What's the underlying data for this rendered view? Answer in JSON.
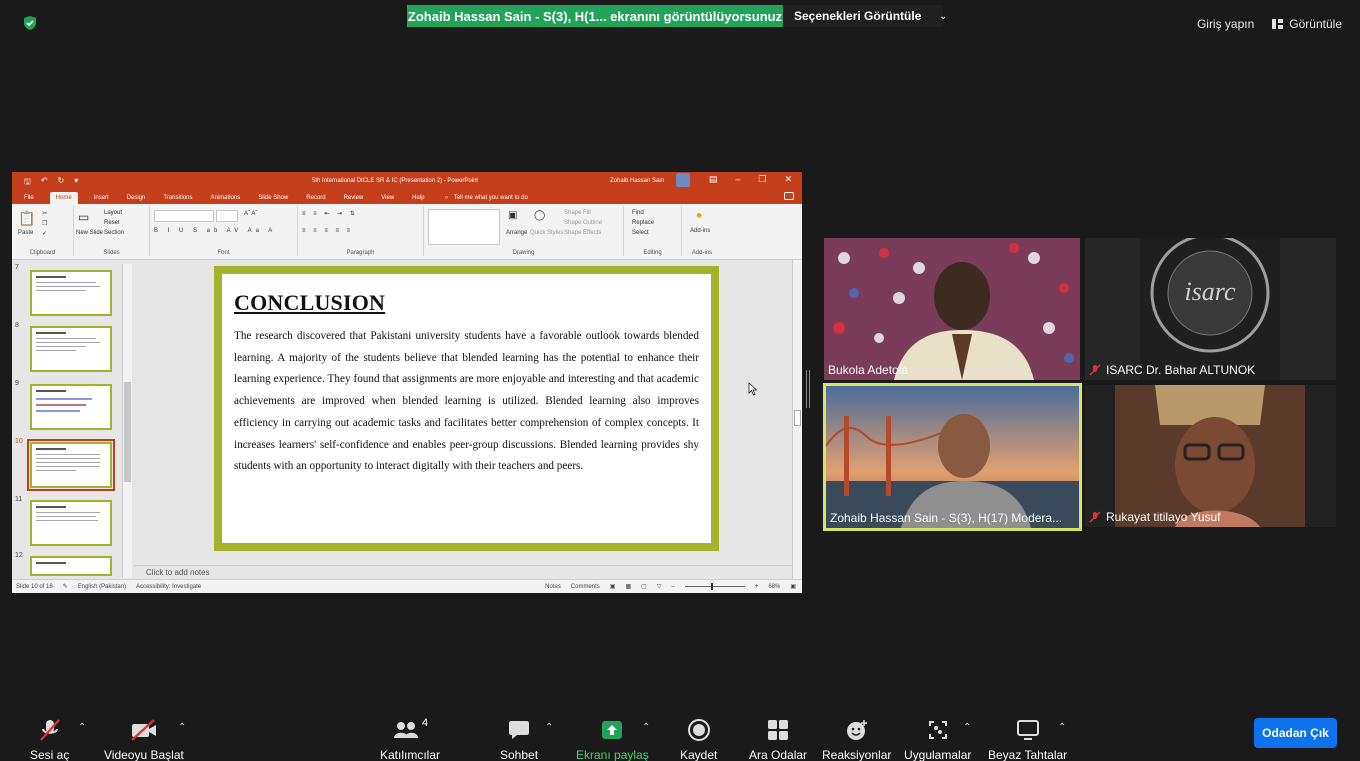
{
  "topbar": {
    "share_banner": "Zohaib Hassan Sain - S(3), H(1... ekranını görüntülüyorsunuz",
    "view_options": "Seçenekleri Görüntüle",
    "sign_in": "Giriş yapın",
    "view": "Görüntüle"
  },
  "ppt": {
    "window_title": "5th International DICLE SR & IC (Presentation 2) - PowerPoint",
    "user": "Zohaib Hassan Sain",
    "tabs": [
      "File",
      "Home",
      "Insert",
      "Design",
      "Transitions",
      "Animations",
      "Slide Show",
      "Record",
      "Review",
      "View",
      "Help"
    ],
    "tell_me": "Tell me what you want to do",
    "ribbon": {
      "paste": "Paste",
      "clipboard": "Clipboard",
      "new_slide": "New Slide",
      "layout": "Layout",
      "reset": "Reset",
      "section": "Section",
      "slides": "Slides",
      "font": "Font",
      "paragraph": "Paragraph",
      "arrange": "Arrange",
      "quick_styles": "Quick Styles",
      "shape_fill": "Shape Fill",
      "shape_outline": "Shape Outline",
      "shape_effects": "Shape Effects",
      "drawing": "Drawing",
      "find": "Find",
      "replace": "Replace",
      "select": "Select",
      "editing": "Editing",
      "addins": "Add-ins",
      "addins_group": "Add-ins"
    },
    "thumbs": [
      {
        "num": "7"
      },
      {
        "num": "8"
      },
      {
        "num": "9"
      },
      {
        "num": "10"
      },
      {
        "num": "11"
      },
      {
        "num": "12"
      }
    ],
    "slide": {
      "title": "CONCLUSION",
      "body": "The research discovered that Pakistani university students have a favorable outlook towards blended learning. A majority of the students believe that blended learning has the potential to enhance their learning experience. They found that assignments are more enjoyable and interesting and that academic achievements are improved when blended learning is utilized. Blended learning also improves efficiency in carrying out academic tasks and facilitates better comprehension of complex concepts. It increases learners' self-confidence and enables peer-group discussions. Blended learning provides shy students with an opportunity to interact digitally with their teachers and peers."
    },
    "notes_placeholder": "Click to add notes",
    "status": {
      "slide_of": "Slide 10 of 16",
      "language": "English (Pakistan)",
      "accessibility": "Accessibility: Investigate",
      "notes": "Notes",
      "comments": "Comments",
      "zoom": "68%"
    }
  },
  "participants": [
    {
      "name": "Bukola Adetola",
      "muted": false
    },
    {
      "name": "ISARC Dr. Bahar ALTUNOK",
      "muted": true
    },
    {
      "name": "Zohaib Hassan Sain - S(3), H(17) Modera...",
      "muted": false
    },
    {
      "name": "Rukayat titilayo Yusuf",
      "muted": true
    }
  ],
  "toolbar": {
    "unmute": "Sesi aç",
    "start_video": "Videoyu Başlat",
    "participants": "Katılımcılar",
    "participants_count": "4",
    "chat": "Sohbet",
    "share_screen": "Ekranı paylaş",
    "record": "Kaydet",
    "breakout": "Ara Odalar",
    "reactions": "Reaksiyonlar",
    "apps": "Uygulamalar",
    "whiteboards": "Beyaz Tahtalar",
    "leave": "Odadan Çık"
  },
  "colors": {
    "share_green": "#23a35a",
    "ppt_red": "#c43e1c",
    "slide_border": "#a3b32a",
    "leave_blue": "#0e72ed",
    "active_speaker": "#d8e36a"
  }
}
